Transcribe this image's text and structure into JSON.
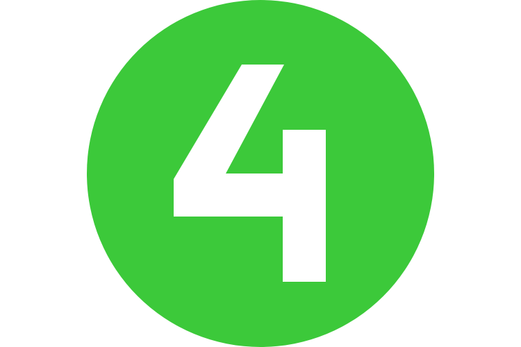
{
  "badge": {
    "number": "4",
    "circle_color": "#3CC93A",
    "digit_color": "#FFFFFF",
    "background_color": "#FFFFFF"
  }
}
